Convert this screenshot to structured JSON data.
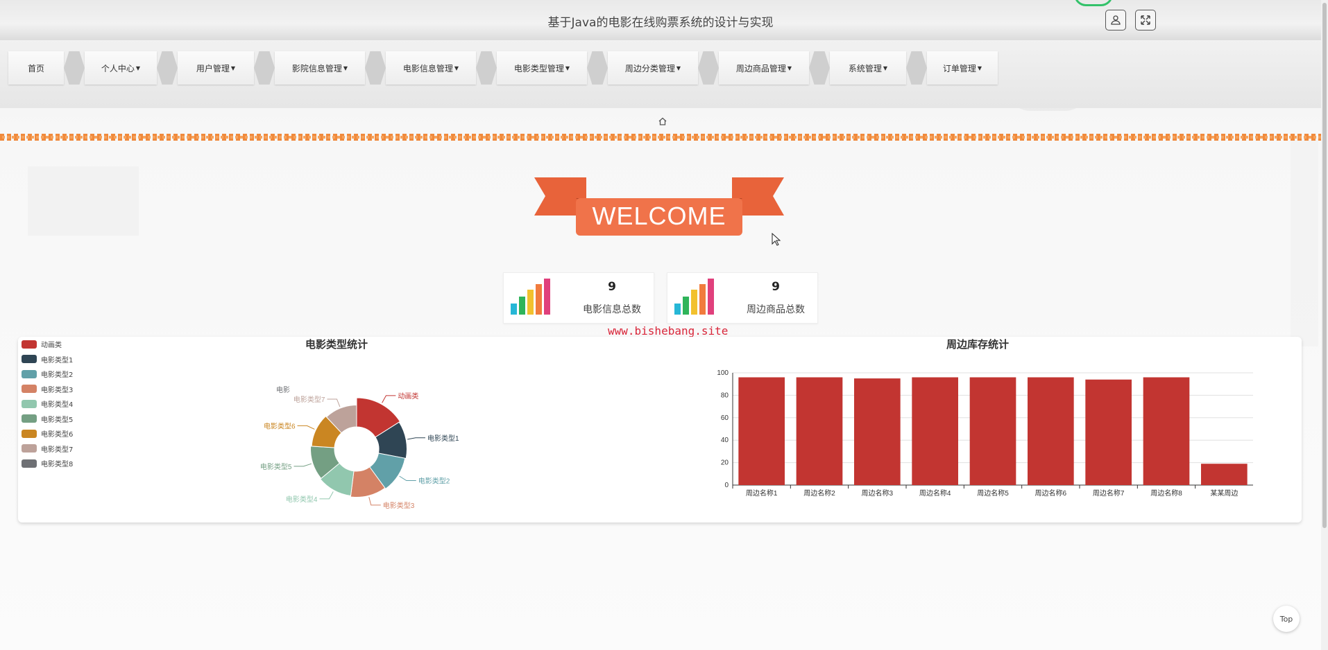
{
  "header": {
    "title": "基于Java的电影在线购票系统的设计与实现"
  },
  "nav": {
    "items": [
      {
        "label": "首页",
        "dropdown": false
      },
      {
        "label": "个人中心",
        "dropdown": true
      },
      {
        "label": "用户管理",
        "dropdown": true
      },
      {
        "label": "影院信息管理",
        "dropdown": true
      },
      {
        "label": "电影信息管理",
        "dropdown": true
      },
      {
        "label": "电影类型管理",
        "dropdown": true
      },
      {
        "label": "周边分类管理",
        "dropdown": true
      },
      {
        "label": "周边商品管理",
        "dropdown": true
      },
      {
        "label": "系统管理",
        "dropdown": true
      },
      {
        "label": "订单管理",
        "dropdown": true
      }
    ]
  },
  "welcome": {
    "text": "WELCOME"
  },
  "stats": [
    {
      "value": "9",
      "label": "电影信息总数"
    },
    {
      "value": "9",
      "label": "周边商品总数"
    }
  ],
  "watermark": "www.bishebang.site",
  "top_button": "Top",
  "colors": {
    "accent": "#c23531",
    "ribbon": "#f0734a",
    "dashed": "#f08a3c"
  },
  "chart_data": [
    {
      "type": "pie",
      "title": "电影类型统计",
      "legend_position": "top-left",
      "series": [
        {
          "name": "动画类",
          "value": 16,
          "color": "#c23531"
        },
        {
          "name": "电影类型1",
          "value": 12,
          "color": "#2f4554"
        },
        {
          "name": "电影类型2",
          "value": 12,
          "color": "#61a0a8"
        },
        {
          "name": "电影类型3",
          "value": 12,
          "color": "#d48265"
        },
        {
          "name": "电影类型4",
          "value": 12,
          "color": "#91c7ae"
        },
        {
          "name": "电影类型5",
          "value": 12,
          "color": "#749f83"
        },
        {
          "name": "电影类型6",
          "value": 12,
          "color": "#ca8622"
        },
        {
          "name": "电影类型7",
          "value": 12,
          "color": "#bda29a"
        },
        {
          "name": "电影类型8",
          "value": 0,
          "color": "#6e7074"
        }
      ],
      "outside_labels": [
        "动画类",
        "电影类型1",
        "电影类型2",
        "电影类型3",
        "电影类型4",
        "电影类型5",
        "电影类型6",
        "电影类型7",
        "电影"
      ]
    },
    {
      "type": "bar",
      "title": "周边库存统计",
      "categories": [
        "周边名称1",
        "周边名称2",
        "周边名称3",
        "周边名称4",
        "周边名称5",
        "周边名称6",
        "周边名称7",
        "周边名称8",
        "某某周边"
      ],
      "values": [
        96,
        96,
        95,
        96,
        96,
        96,
        94,
        96,
        19
      ],
      "ylim": [
        0,
        100
      ],
      "yticks": [
        0,
        20,
        40,
        60,
        80,
        100
      ],
      "color": "#c23531",
      "grid": true
    }
  ]
}
